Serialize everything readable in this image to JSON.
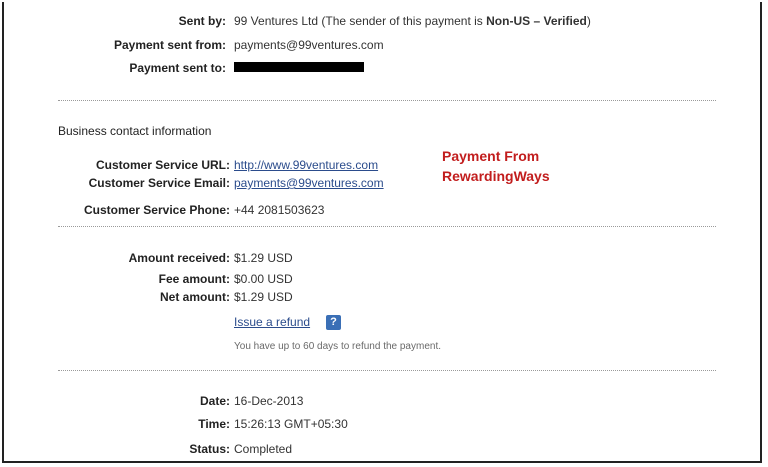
{
  "sender": {
    "sent_by_label": "Sent by:",
    "sent_by_prefix": "99 Ventures Ltd (The sender of this payment is ",
    "sent_by_status": "Non-US – Verified",
    "sent_by_suffix": ")",
    "sent_from_label": "Payment sent from:",
    "sent_from_value": "payments@99ventures.com",
    "sent_to_label": "Payment sent to:"
  },
  "contact": {
    "section_title": "Business contact information",
    "url_label": "Customer Service URL:",
    "url_value": "http://www.99ventures.com",
    "email_label": "Customer Service Email:",
    "email_value": "payments@99ventures.com",
    "phone_label": "Customer Service Phone:",
    "phone_value": "+44 2081503623"
  },
  "annotation": {
    "line1": "Payment From",
    "line2": "RewardingWays",
    "color": "#c21d1d"
  },
  "amounts": {
    "received_label": "Amount received:",
    "received_value": "$1.29 USD",
    "fee_label": "Fee amount:",
    "fee_value": "$0.00 USD",
    "net_label": "Net amount:",
    "net_value": "$1.29 USD",
    "refund_link": "Issue a refund",
    "help_icon": "?",
    "refund_note": "You have up to 60 days to refund the payment."
  },
  "details": {
    "date_label": "Date:",
    "date_value": "16-Dec-2013",
    "time_label": "Time:",
    "time_value": "15:26:13 GMT+05:30",
    "status_label": "Status:",
    "status_value": "Completed"
  },
  "colors": {
    "link": "#2b4c8c",
    "help_badge": "#3a6fb6"
  }
}
